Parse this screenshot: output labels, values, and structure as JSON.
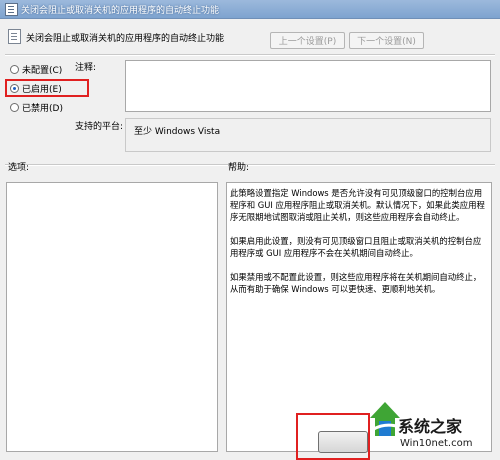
{
  "window": {
    "title": "关闭会阻止或取消关机的应用程序的自动终止功能"
  },
  "header": {
    "title": "关闭会阻止或取消关机的应用程序的自动终止功能",
    "prev_label": "上一个设置(P)",
    "next_label": "下一个设置(N)"
  },
  "state": {
    "options": [
      {
        "label": "未配置(C)",
        "checked": false
      },
      {
        "label": "已启用(E)",
        "checked": true
      },
      {
        "label": "已禁用(D)",
        "checked": false
      }
    ]
  },
  "comment": {
    "label": "注释:",
    "value": ""
  },
  "platform": {
    "label": "支持的平台:",
    "value": "至少 Windows Vista"
  },
  "options_section": {
    "label": "选项:"
  },
  "help_section": {
    "label": "帮助:",
    "paragraphs": [
      "此策略设置指定 Windows 是否允许没有可见顶级窗口的控制台应用程序和 GUI 应用程序阻止或取消关机。默认情况下，如果此类应用程序无限期地试图取消或阻止关机，则这些应用程序会自动终止。",
      "如果启用此设置，则没有可见顶级窗口且阻止或取消关机的控制台应用程序或 GUI 应用程序不会在关机期间自动终止。",
      "如果禁用或不配置此设置，则这些应用程序将在关机期间自动终止，从而有助于确保 Windows 可以更快速、更顺利地关机。"
    ]
  },
  "watermark": {
    "brand": "系统之家",
    "url": "Win10net.com"
  },
  "colors": {
    "highlight": "#e02020",
    "title_bar": "#8fb0d8"
  }
}
